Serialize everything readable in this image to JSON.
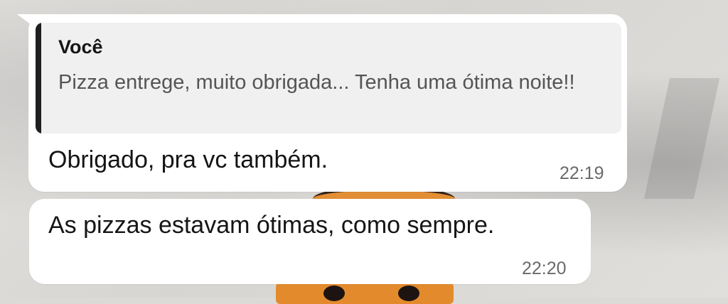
{
  "chat": {
    "messages": [
      {
        "quote": {
          "author": "Você",
          "text": "Pizza entrege, muito obrigada... Tenha uma ótima noite!!"
        },
        "text": "Obrigado, pra vc também.",
        "time": "22:19"
      },
      {
        "text": "As pizzas estavam ótimas, como sempre.",
        "time": "22:20"
      }
    ]
  },
  "colors": {
    "bubble": "#ffffff",
    "quote_background": "#f0f0f0",
    "quote_bar": "#1f1f1f",
    "text": "#151515",
    "muted_text": "#555555",
    "timestamp": "#6a6a6a",
    "wallpaper_accent": "#e38b2c"
  }
}
